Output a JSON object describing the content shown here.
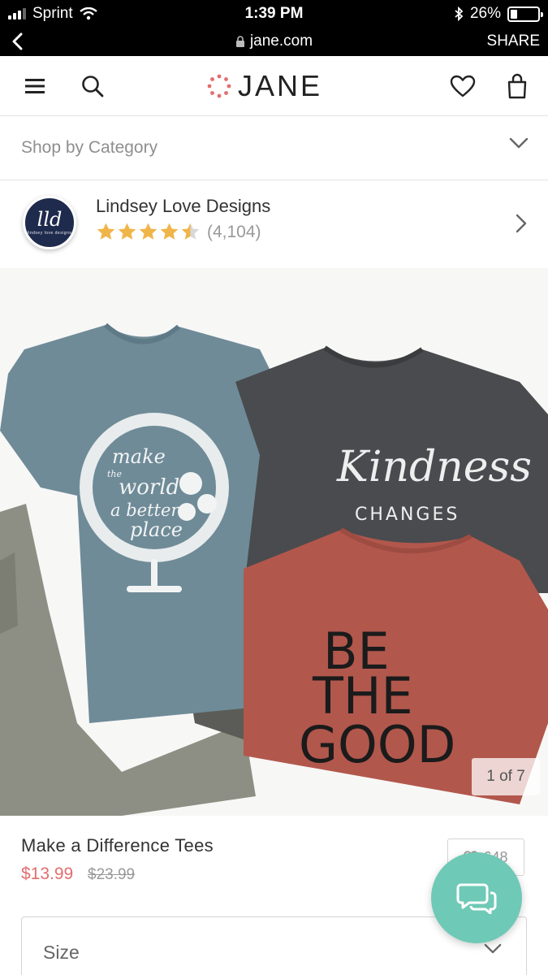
{
  "status_bar": {
    "carrier": "Sprint",
    "time": "1:39 PM",
    "battery": "26%",
    "battery_level": 0.26
  },
  "browser": {
    "url": "jane.com",
    "share_label": "SHARE"
  },
  "header": {
    "logo_text": "JANE"
  },
  "category": {
    "label": "Shop by Category"
  },
  "seller": {
    "avatar_text": "lld",
    "avatar_subtext": "lindsey love designs",
    "name": "Lindsey Love Designs",
    "rating": 4.5,
    "review_count": "(4,104)"
  },
  "product": {
    "image_counter": "1 of 7",
    "shirt_texts": {
      "globe_lines": [
        "make",
        "the",
        "world",
        "a better",
        "place"
      ],
      "kindness": "Kindness",
      "changes": "CHANGES",
      "be": "BE",
      "the": "THE",
      "good": "GOOD"
    },
    "title": "Make a Difference Tees",
    "price": "$13.99",
    "original_price": "$23.99",
    "favorites_count": "648",
    "size_label": "Size"
  },
  "colors": {
    "accent": "#e36d6d",
    "star": "#f0b54a",
    "chat": "#6ec9b6",
    "shirt_blue": "#6f8b98",
    "shirt_gray": "#4a4b4e",
    "shirt_rust": "#b2574c"
  }
}
